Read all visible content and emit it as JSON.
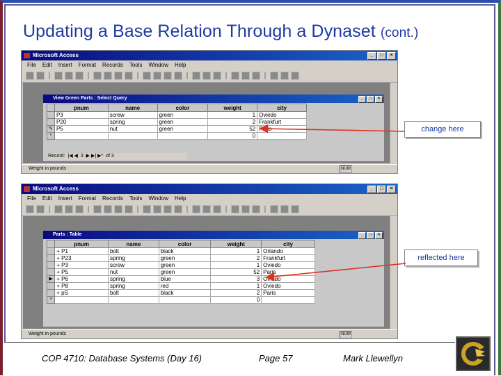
{
  "slide": {
    "title_main": "Updating a Base Relation Through a Dynaset",
    "title_sub": "(cont.)"
  },
  "app_windows": [
    {
      "title": "Microsoft Access",
      "menu": [
        "File",
        "Edit",
        "Insert",
        "Format",
        "Records",
        "Tools",
        "Window",
        "Help"
      ],
      "subwindow_title": "View Green Parts : Select Query",
      "columns": [
        "pnum",
        "name",
        "color",
        "weight",
        "city"
      ],
      "rows": [
        {
          "sel": "",
          "pnum": "P3",
          "name": "screw",
          "color": "green",
          "weight": "1",
          "city": "Oviedo"
        },
        {
          "sel": "",
          "pnum": "P20",
          "name": "spring",
          "color": "green",
          "weight": "2",
          "city": "Frankfurt"
        },
        {
          "sel": "✎",
          "pnum": "P5",
          "name": "nut",
          "color": "green",
          "weight": "52",
          "city": "Paris"
        },
        {
          "sel": "*",
          "pnum": "",
          "name": "",
          "color": "",
          "weight": "0",
          "city": ""
        }
      ],
      "nav": {
        "label": "Record:",
        "current": "3",
        "of": "of 3"
      },
      "status": "Weight in pounds",
      "num": "NUM"
    },
    {
      "title": "Microsoft Access",
      "menu": [
        "File",
        "Edit",
        "Insert",
        "Format",
        "Records",
        "Tools",
        "Window",
        "Help"
      ],
      "subwindow_title": "Parts : Table",
      "columns": [
        "pnum",
        "name",
        "color",
        "weight",
        "city"
      ],
      "rows": [
        {
          "sel": "",
          "pnum": "P1",
          "name": "bolt",
          "color": "black",
          "weight": "1",
          "city": "Orlando"
        },
        {
          "sel": "",
          "pnum": "P23",
          "name": "spring",
          "color": "green",
          "weight": "2",
          "city": "Frankfurt"
        },
        {
          "sel": "",
          "pnum": "P3",
          "name": "screw",
          "color": "green",
          "weight": "1",
          "city": "Oviedo"
        },
        {
          "sel": "",
          "pnum": "P5",
          "name": "nut",
          "color": "green",
          "weight": "52",
          "city": "Paris"
        },
        {
          "sel": "▶",
          "pnum": "P6",
          "name": "spring",
          "color": "blue",
          "weight": "3",
          "city": "Oviedo"
        },
        {
          "sel": "",
          "pnum": "P8",
          "name": "spring",
          "color": "red",
          "weight": "1",
          "city": "Oviedo"
        },
        {
          "sel": "",
          "pnum": "pS",
          "name": "bolt",
          "color": "black",
          "weight": "2",
          "city": "Paris"
        },
        {
          "sel": "*",
          "pnum": "",
          "name": "",
          "color": "",
          "weight": "0",
          "city": ""
        }
      ],
      "status": "Weight in pounds",
      "num": "NUM"
    }
  ],
  "callouts": {
    "change": "change here",
    "reflected": "reflected here"
  },
  "footer": {
    "course": "COP 4710: Database Systems  (Day 16)",
    "page": "Page 57",
    "author": "Mark Llewellyn"
  },
  "colors": {
    "title": "#1f3aa0",
    "arrow": "#e03020",
    "titlebar": "#0a0a80"
  }
}
